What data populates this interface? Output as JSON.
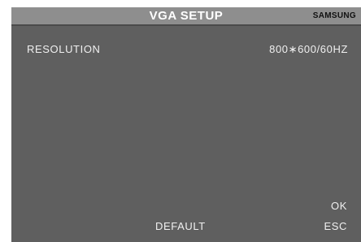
{
  "header": {
    "title": "VGA SETUP",
    "brand": "SAMSUNG"
  },
  "settings": [
    {
      "label": "RESOLUTION",
      "value": "800∗600/60HZ"
    }
  ],
  "actions": {
    "ok_label": "OK",
    "default_label": "DEFAULT",
    "esc_label": "ESC"
  },
  "colors": {
    "background": "#5f5f5f",
    "title_bar": "#8e8e8e",
    "text": "#f0f0f0",
    "brand_text": "#111111"
  }
}
